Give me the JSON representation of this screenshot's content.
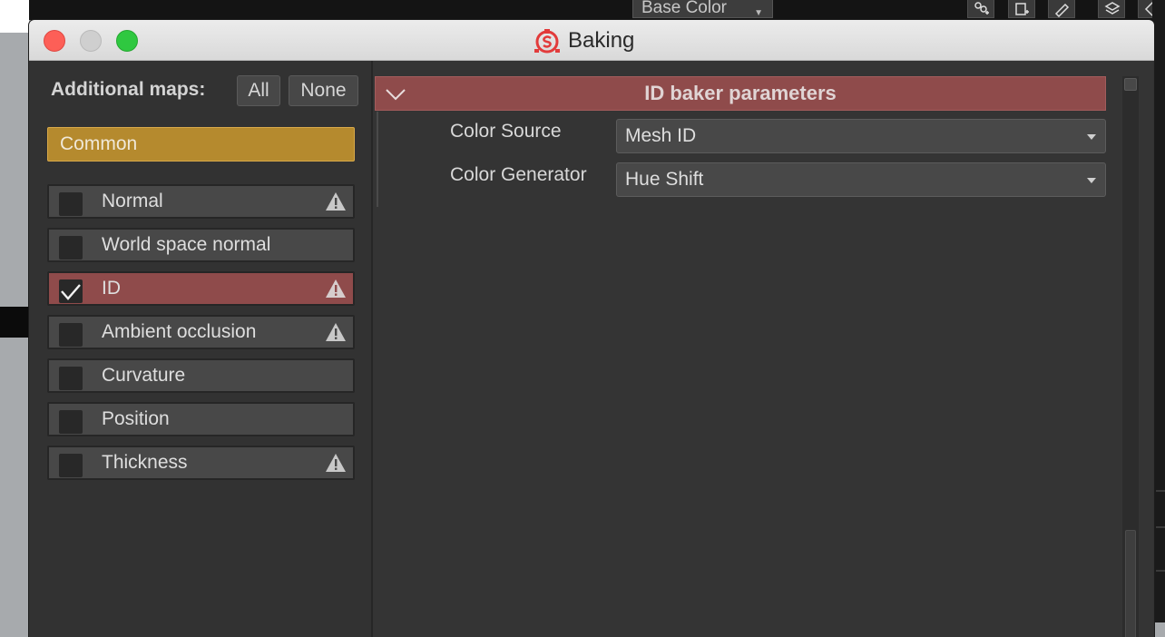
{
  "background_app": {
    "channel_dropdown": "Base Color"
  },
  "window": {
    "title": "Baking",
    "logo_color": "#e23b3b"
  },
  "left_panel": {
    "additional_maps_label": "Additional maps:",
    "all_button": "All",
    "none_button": "None",
    "common_tab": "Common",
    "maps": [
      {
        "label": "Normal",
        "checked": false,
        "selected": false,
        "warning": true
      },
      {
        "label": "World space normal",
        "checked": false,
        "selected": false,
        "warning": false
      },
      {
        "label": "ID",
        "checked": true,
        "selected": true,
        "warning": true
      },
      {
        "label": "Ambient occlusion",
        "checked": false,
        "selected": false,
        "warning": true
      },
      {
        "label": "Curvature",
        "checked": false,
        "selected": false,
        "warning": false
      },
      {
        "label": "Position",
        "checked": false,
        "selected": false,
        "warning": false
      },
      {
        "label": "Thickness",
        "checked": false,
        "selected": false,
        "warning": true
      }
    ]
  },
  "right_panel": {
    "section_title": "ID baker parameters",
    "params": [
      {
        "label": "Color Source",
        "value": "Mesh ID"
      },
      {
        "label": "Color Generator",
        "value": "Hue Shift"
      }
    ]
  },
  "colors": {
    "accent_selected": "#8f4b4b",
    "common_tab": "#b58a2e",
    "panel_bg": "#323232"
  }
}
